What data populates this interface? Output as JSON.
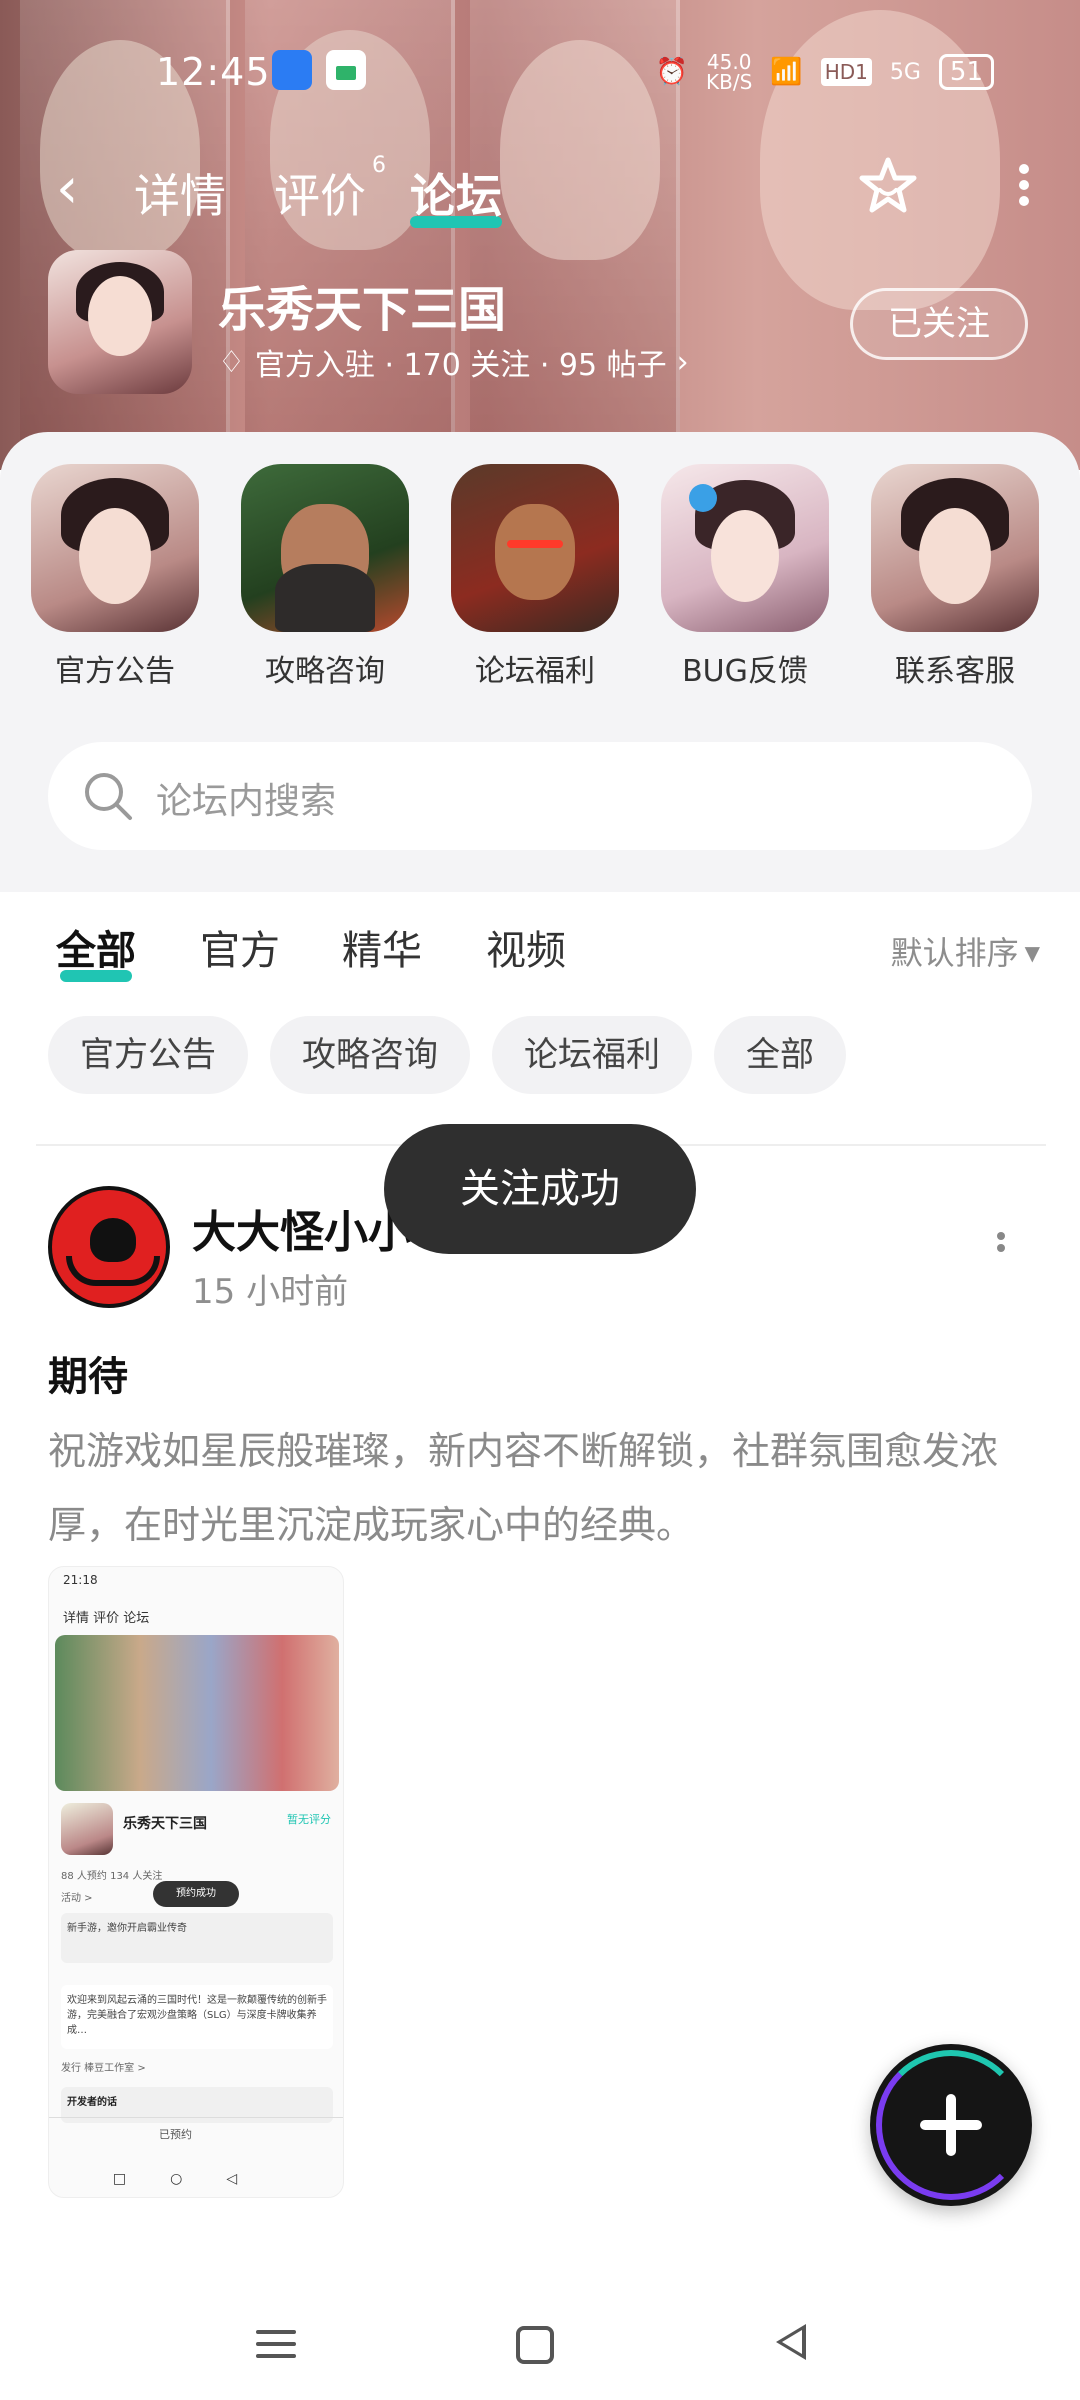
{
  "status_bar": {
    "time": "12:45",
    "speed_value": "45.0",
    "speed_unit": "KB/S",
    "hd": "HD1",
    "network": "5G",
    "battery": "51"
  },
  "top_nav": {
    "tabs": [
      {
        "label": "详情"
      },
      {
        "label": "评价",
        "badge": "6"
      },
      {
        "label": "论坛",
        "active": true
      }
    ]
  },
  "game": {
    "name": "乐秀天下三国",
    "meta": "官方入驻 · 170 关注 · 95 帖子",
    "follow_label": "已关注"
  },
  "shortcuts": [
    {
      "label": "官方公告",
      "icon": "girl-portrait"
    },
    {
      "label": "攻略咨询",
      "icon": "green-general-portrait"
    },
    {
      "label": "论坛福利",
      "icon": "warrior-portrait"
    },
    {
      "label": "BUG反馈",
      "icon": "fairy-portrait"
    },
    {
      "label": "联系客服",
      "icon": "girl-portrait"
    }
  ],
  "search": {
    "placeholder": "论坛内搜索"
  },
  "filter_tabs": [
    {
      "label": "全部",
      "active": true
    },
    {
      "label": "官方"
    },
    {
      "label": "精华"
    },
    {
      "label": "视频"
    }
  ],
  "sort_label": "默认排序",
  "chips": [
    "官方公告",
    "攻略咨询",
    "论坛福利",
    "全部"
  ],
  "post": {
    "author": "大大怪小小",
    "time": "15 小时前",
    "title": "期待",
    "body": "祝游戏如星辰般璀璨，新内容不断解锁，社群氛围愈发浓厚，在时光里沉淀成玩家心中的经典。",
    "screenshot": {
      "status_time": "21:18",
      "nav": "详情  评价  论坛",
      "game_name": "乐秀天下三国",
      "rating": "暂无评分",
      "stats": "88 人预约   134 人关注",
      "activity": "活动 >",
      "toast": "预约成功",
      "preview_text": "新手游，邀你开启霸业传奇",
      "intro": "欢迎来到风起云涌的三国时代！这是一款颠覆传统的创新手游，完美融合了宏观沙盘策略（SLG）与深度卡牌收集养成…",
      "publisher": "发行  棒豆工作室 >",
      "developer_note": "开发者的话",
      "bottom_btn": "已预约"
    }
  },
  "toast": "关注成功"
}
